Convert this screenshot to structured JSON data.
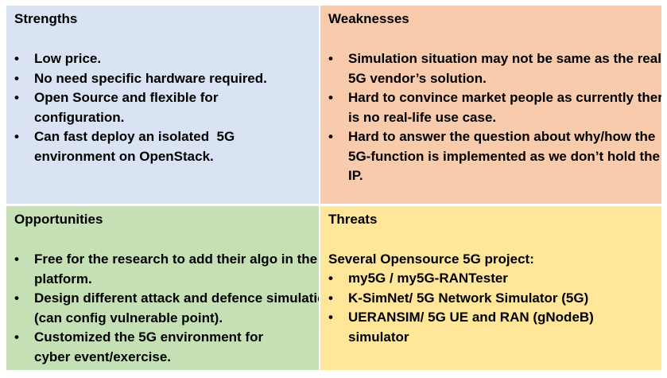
{
  "colors": {
    "strengths_bg": "#dae3f3",
    "weaknesses_bg": "#f8cbad",
    "opportunities_bg": "#c5e0b4",
    "threats_bg": "#ffe699"
  },
  "bullet_char": "•",
  "strengths": {
    "title": "Strengths",
    "items": [
      "Low price.",
      "No need specific hardware required.",
      "Open Source and flexible for configuration.",
      "Can fast deploy an isolated  5G environment on OpenStack."
    ]
  },
  "weaknesses": {
    "title": "Weaknesses",
    "items": [
      "Simulation situation may not be same as the real 5G vendor’s solution.",
      "Hard to convince market people as currently there is no real-life use case.",
      "Hard to answer the question about why/how the 5G-function is implemented as we don’t hold the IP."
    ]
  },
  "opportunities": {
    "title": "Opportunities",
    "items": [
      "Free for the research to add their algo in the platform.",
      "Design different attack and defence simulation (can config vulnerable point).",
      "Customized the 5G environment for cyber event/exercise."
    ]
  },
  "threats": {
    "title": "Threats",
    "intro": "Several Opensource 5G project:",
    "items": [
      "my5G / my5G-RANTester",
      "K-SimNet/ 5G Network Simulator (5G)",
      "UERANSIM/ 5G UE and RAN (gNodeB) simulator"
    ]
  }
}
